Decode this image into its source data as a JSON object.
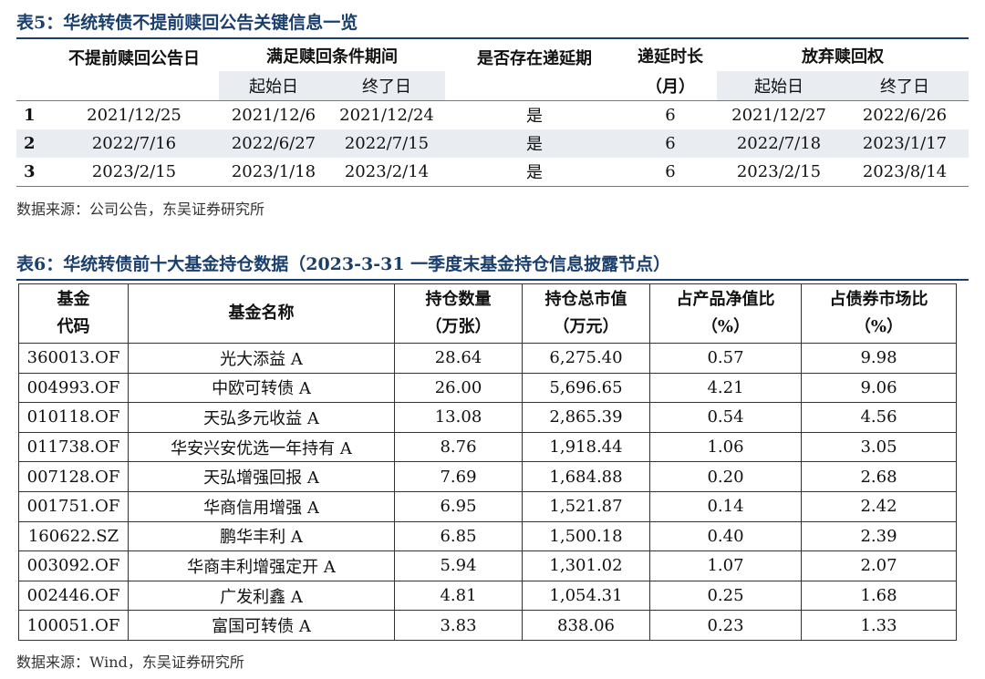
{
  "table5": {
    "caption": "表5：华统转债不提前赎回公告关键信息一览",
    "headers": {
      "announce_date": "不提前赎回公告日",
      "condition_period": "满足赎回条件期间",
      "has_extension": "是否存在递延期",
      "extension_length": "递延时长",
      "extension_unit": "（月）",
      "waive_right": "放弃赎回权",
      "start": "起始日",
      "end": "终了日"
    },
    "rows": [
      {
        "idx": "1",
        "announce": "2021/12/25",
        "cond_start": "2021/12/6",
        "cond_end": "2021/12/24",
        "has_ext": "是",
        "ext_len": "6",
        "waive_start": "2021/12/27",
        "waive_end": "2022/6/26"
      },
      {
        "idx": "2",
        "announce": "2022/7/16",
        "cond_start": "2022/6/27",
        "cond_end": "2022/7/15",
        "has_ext": "是",
        "ext_len": "6",
        "waive_start": "2022/7/18",
        "waive_end": "2023/1/17"
      },
      {
        "idx": "3",
        "announce": "2023/2/15",
        "cond_start": "2023/1/18",
        "cond_end": "2023/2/14",
        "has_ext": "是",
        "ext_len": "6",
        "waive_start": "2023/2/15",
        "waive_end": "2023/8/14"
      }
    ],
    "source": "数据来源：公司公告，东吴证券研究所"
  },
  "table6": {
    "caption": "表6：华统转债前十大基金持仓数据（2023-3-31 一季度末基金持仓信息披露节点）",
    "headers": {
      "code_1": "基金",
      "code_2": "代码",
      "name": "基金名称",
      "qty_1": "持仓数量",
      "qty_2": "（万张）",
      "mv_1": "持仓总市值",
      "mv_2": "（万元）",
      "nav_1": "占产品净值比",
      "nav_2": "（%）",
      "bond_1": "占债券市场比",
      "bond_2": "（%）"
    },
    "rows": [
      {
        "code": "360013.OF",
        "name": "光大添益 A",
        "qty": "28.64",
        "mv": "6,275.40",
        "nav": "0.57",
        "bond": "9.98"
      },
      {
        "code": "004993.OF",
        "name": "中欧可转债 A",
        "qty": "26.00",
        "mv": "5,696.65",
        "nav": "4.21",
        "bond": "9.06"
      },
      {
        "code": "010118.OF",
        "name": "天弘多元收益 A",
        "qty": "13.08",
        "mv": "2,865.39",
        "nav": "0.54",
        "bond": "4.56"
      },
      {
        "code": "011738.OF",
        "name": "华安兴安优选一年持有 A",
        "qty": "8.76",
        "mv": "1,918.44",
        "nav": "1.06",
        "bond": "3.05"
      },
      {
        "code": "007128.OF",
        "name": "天弘增强回报 A",
        "qty": "7.69",
        "mv": "1,684.88",
        "nav": "0.20",
        "bond": "2.68"
      },
      {
        "code": "001751.OF",
        "name": "华商信用增强 A",
        "qty": "6.95",
        "mv": "1,521.87",
        "nav": "0.14",
        "bond": "2.42"
      },
      {
        "code": "160622.SZ",
        "name": "鹏华丰利 A",
        "qty": "6.85",
        "mv": "1,500.18",
        "nav": "0.40",
        "bond": "2.39"
      },
      {
        "code": "003092.OF",
        "name": "华商丰利增强定开 A",
        "qty": "5.94",
        "mv": "1,301.02",
        "nav": "1.07",
        "bond": "2.07"
      },
      {
        "code": "002446.OF",
        "name": "广发利鑫 A",
        "qty": "4.81",
        "mv": "1,054.31",
        "nav": "0.25",
        "bond": "1.68"
      },
      {
        "code": "100051.OF",
        "name": "富国可转债 A",
        "qty": "3.83",
        "mv": "838.06",
        "nav": "0.23",
        "bond": "1.33"
      }
    ],
    "source": "数据来源：Wind，东吴证券研究所"
  }
}
